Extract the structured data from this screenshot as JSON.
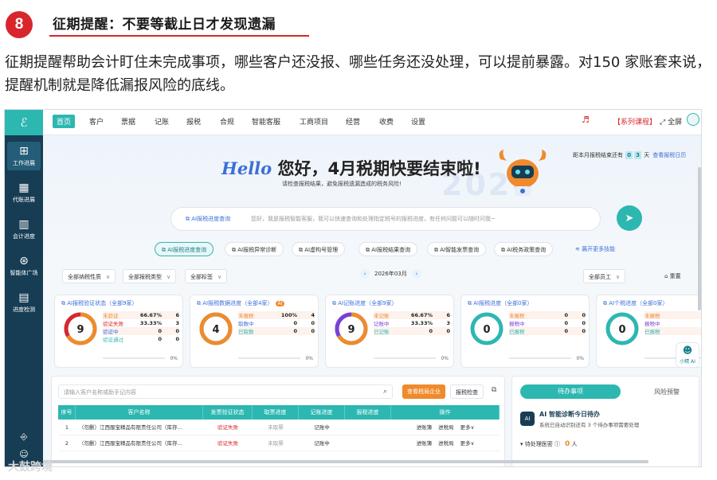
{
  "section": {
    "number": "8",
    "title": "征期提醒：不要等截止日才发现遗漏"
  },
  "paragraph": "征期提醒帮助会计盯住未完成事项，哪些客户还没报、哪些任务还没处理，可以提前暴露。对150 家账套来说，提醒机制就是降低漏报风险的底线。",
  "app": {
    "logo": "ℰ",
    "nav": [
      "首页",
      "客户",
      "票据",
      "记账",
      "报税",
      "合规",
      "智能客服",
      "工商项目",
      "经营",
      "收费",
      "设置"
    ],
    "nav_active": "首页",
    "top_right": {
      "course": "【系列课程】",
      "fullscreen": "全屏"
    },
    "sidebar": [
      {
        "label": "工作进展",
        "icon": "grid-icon"
      },
      {
        "label": "代账进展",
        "icon": "table-icon"
      },
      {
        "label": "会计进度",
        "icon": "bar-chart-icon"
      },
      {
        "label": "智能体广场",
        "icon": "node-icon"
      },
      {
        "label": "进度检测",
        "icon": "chart-icon"
      }
    ],
    "banner": {
      "hello": "Hello",
      "title": " 您好，4月税期快要结束啦!",
      "subtitle": "请检查报税结果，避免报税遗漏造成的税务风险!",
      "watermark_year": "2026",
      "countdown_prefix": "距本月报税结束还有",
      "countdown_d1": "0",
      "countdown_d2": "3",
      "countdown_suffix": "天",
      "countdown_link": "查看报税日历"
    },
    "search": {
      "tag": "AI报税进度查询",
      "placeholder": "您好，我是报税智能客服，我可以快速查询和处理指定税号的报税进度，有任何问题可以随时问我~"
    },
    "pills": [
      "AI报税进度查询",
      "AI报税异常诊断",
      "AI虚构号管理",
      "AI报税结果查询",
      "AI智能发票查询",
      "AI税务政策查询"
    ],
    "pill_more": "展开更多技能",
    "filters": {
      "tax_type": "全部纳税性质",
      "report_type": "全部报税类型",
      "tags": "全部标签",
      "month": "2026年03月",
      "staff": "全部员工",
      "reset": "重置"
    },
    "cards": [
      {
        "title": "AI报税验证状态（全部9家）",
        "center": "9",
        "colors": [
          "#f08a2c",
          "#d8262c",
          "#3b6fd8",
          "#2db7b1"
        ],
        "rows": [
          {
            "label": "未验证",
            "pct": "66.67%",
            "count": "6",
            "color": "#f08a2c"
          },
          {
            "label": "验证失败",
            "pct": "33.33%",
            "count": "3",
            "color": "#d8262c"
          },
          {
            "label": "验证中",
            "pct": "0",
            "count": "0",
            "color": "#3b6fd8"
          },
          {
            "label": "验证通过",
            "pct": "0",
            "count": "0",
            "color": "#2db7b1"
          }
        ],
        "fractions": [
          0.6667,
          0.3333,
          0,
          0
        ],
        "foot": "0%"
      },
      {
        "title": "AI报税数据进度（全部4家）",
        "tag": "AI",
        "center": "4",
        "colors": [
          "#f08a2c",
          "#3b6fd8",
          "#2db7b1"
        ],
        "rows": [
          {
            "label": "未报税",
            "pct": "100%",
            "count": "4",
            "color": "#f08a2c"
          },
          {
            "label": "取数中",
            "pct": "0",
            "count": "0",
            "color": "#3b6fd8"
          },
          {
            "label": "已取数",
            "pct": "0",
            "count": "0",
            "color": "#2db7b1"
          }
        ],
        "fractions": [
          1,
          0,
          0
        ],
        "foot": "0%"
      },
      {
        "title": "AI记账进度（全部9家）",
        "center": "9",
        "colors": [
          "#f08a2c",
          "#7b3fd8",
          "#2db7b1"
        ],
        "rows": [
          {
            "label": "未记账",
            "pct": "66.67%",
            "count": "6",
            "color": "#f08a2c"
          },
          {
            "label": "记账中",
            "pct": "33.33%",
            "count": "3",
            "color": "#7b3fd8"
          },
          {
            "label": "已记账",
            "pct": "0",
            "count": "0",
            "color": "#2db7b1"
          }
        ],
        "fractions": [
          0.6667,
          0.3333,
          0
        ],
        "foot": "0%"
      },
      {
        "title": "AI报税进度（全部0家）",
        "center": "0",
        "colors": [
          "#f08a2c",
          "#7b3fd8",
          "#2db7b1"
        ],
        "rows": [
          {
            "label": "未报税",
            "pct": "0",
            "count": "0",
            "color": "#f08a2c"
          },
          {
            "label": "报税中",
            "pct": "0",
            "count": "0",
            "color": "#7b3fd8"
          },
          {
            "label": "已报税",
            "pct": "0",
            "count": "0",
            "color": "#2db7b1"
          }
        ],
        "fractions": [
          0,
          0,
          0
        ],
        "foot": "0%"
      },
      {
        "title": "AI个税进度（全部0家）",
        "center": "0",
        "colors": [
          "#f08a2c",
          "#7b3fd8",
          "#2db7b1"
        ],
        "rows": [
          {
            "label": "未报税",
            "pct": "",
            "count": "0",
            "color": "#f08a2c"
          },
          {
            "label": "报税中",
            "pct": "",
            "count": "0",
            "color": "#7b3fd8"
          },
          {
            "label": "已报税",
            "pct": "",
            "count": "0",
            "color": "#2db7b1"
          }
        ],
        "fractions": [
          0,
          0,
          0
        ],
        "foot": ""
      }
    ],
    "float_ai": "小精 AI",
    "table": {
      "search_placeholder": "请输入客户名称或助手记内容",
      "btn_primary": "查看税局企业",
      "btn_secondary": "报税检查",
      "headers": [
        "序号",
        "客户名称",
        "发票验证状态",
        "取票进度",
        "记账进度",
        "报税进度",
        "操作"
      ],
      "rows": [
        {
          "no": "1",
          "name": "（勿删）江西服宝精品有限责任公司（库存…",
          "verify": "验证失败",
          "fetch": "未取票",
          "book": "记账中",
          "tax": "",
          "ops": [
            "进账簿",
            "进税局",
            "更多∨"
          ]
        },
        {
          "no": "2",
          "name": "（勿删）江西服宝精品有限责任公司（库存…",
          "verify": "验证失败",
          "fetch": "未取票",
          "book": "记账中",
          "tax": "",
          "ops": [
            "进账簿",
            "进税局",
            "更多∨"
          ]
        }
      ]
    },
    "todo": {
      "tab_active": "待办事项",
      "tab_other": "风险预警",
      "ai_title": "AI 智能诊断今日待办",
      "ai_sub": "系统已自动识别还有 3 个待办事项需要处理",
      "line_label": "待处理医密",
      "line_num": "0",
      "line_unit": "人"
    }
  },
  "watermark": "大鼓跨境"
}
